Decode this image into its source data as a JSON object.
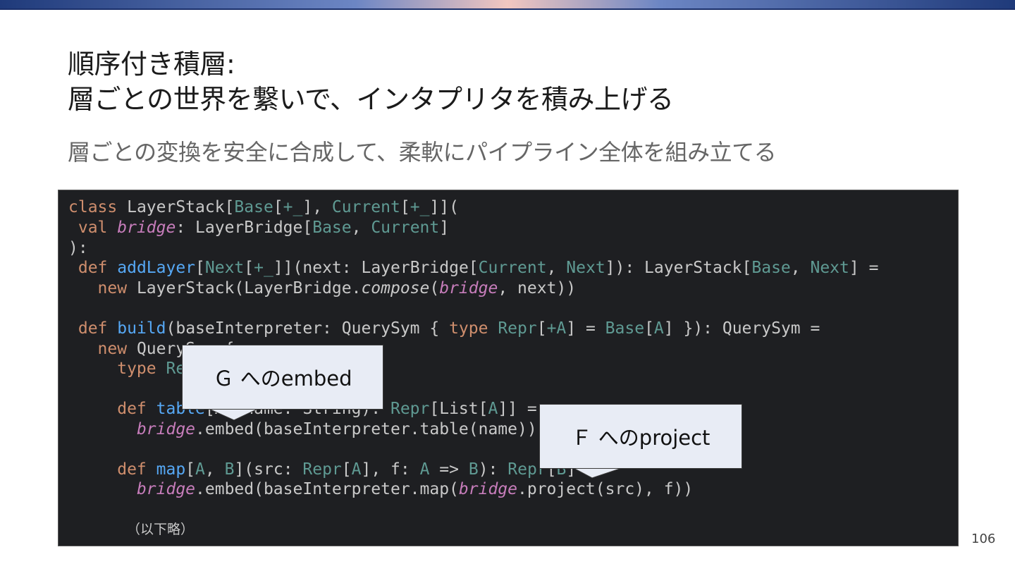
{
  "slide": {
    "title_line1": "順序付き積層:",
    "title_line2": "層ごとの世界を繋いで、インタプリタを積み上げる",
    "subtitle": "層ごとの変換を安全に合成して、柔軟にパイプライン全体を組み立てる",
    "page_number": "106"
  },
  "code": {
    "omitted_note": "（以下略）",
    "line1": {
      "a": "class",
      "b": " LayerStack[",
      "c": "Base",
      "d": "[",
      "e": "+_",
      "f": "], ",
      "g": "Current",
      "h": "[",
      "i": "+_",
      "j": "]]("
    },
    "line2": {
      "a": " val ",
      "b": "bridge",
      "c": ": LayerBridge[",
      "d": "Base",
      "e": ", ",
      "f": "Current",
      "g": "]"
    },
    "line3": {
      "a": "):"
    },
    "line4": {
      "a": " def ",
      "b": "addLayer",
      "c": "[",
      "d": "Next",
      "e": "[",
      "f": "+_",
      "g": "]](next: LayerBridge[",
      "h": "Current",
      "i": ", ",
      "j": "Next",
      "k": "]): LayerStack[",
      "l": "Base",
      "m": ", ",
      "n": "Next",
      "o": "] ="
    },
    "line5": {
      "a": "   new ",
      "b": "LayerStack(LayerBridge.",
      "c": "compose",
      "d": "(",
      "e": "bridge",
      "f": ", next))"
    },
    "line7": {
      "a": " def ",
      "b": "build",
      "c": "(baseInterpreter: QuerySym { ",
      "d": "type ",
      "e": "Repr",
      "f": "[",
      "g": "+A",
      "h": "] = ",
      "i": "Base",
      "j": "[",
      "k": "A",
      "l": "] }): QuerySym ="
    },
    "line8": {
      "a": "   new ",
      "b": "QuerySym {"
    },
    "line9": {
      "a": "     type ",
      "b": "Repr"
    },
    "line11": {
      "a": "     def ",
      "b": "table",
      "c": "[A](name: String): ",
      "d": "Repr",
      "e": "[List[",
      "f": "A",
      "g": "]] ="
    },
    "line12": {
      "a": "       ",
      "b": "bridge",
      "c": ".embed(baseInterpreter.table(name))"
    },
    "line14": {
      "a": "     def ",
      "b": "map",
      "c": "[",
      "d": "A",
      "e": ", ",
      "f": "B",
      "g": "](src: ",
      "h": "Repr",
      "i": "[",
      "j": "A",
      "k": "], f: ",
      "l": "A",
      "m": " => ",
      "n": "B",
      "o": "): ",
      "p": "Repr",
      "q": "[",
      "r": "B",
      "s": "] ="
    },
    "line15": {
      "a": "       ",
      "b": "bridge",
      "c": ".embed(baseInterpreter.map(",
      "d": "bridge",
      "e": ".project(src), f))"
    }
  },
  "callouts": {
    "embed": "Ｇ へのembed",
    "project": "Ｆ へのproject"
  }
}
